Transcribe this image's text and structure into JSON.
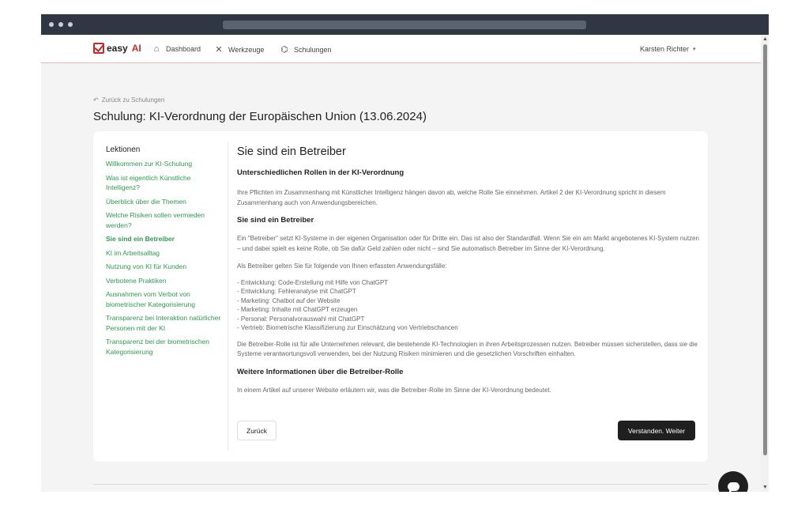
{
  "nav": {
    "logo_text": "easy",
    "logo_ai": "AI",
    "items": [
      {
        "label": "Dashboard",
        "icon": "home-icon"
      },
      {
        "label": "Werkzeuge",
        "icon": "tools-icon"
      },
      {
        "label": "Schulungen",
        "icon": "graduation-cap-icon"
      }
    ],
    "user": "Karsten Richter"
  },
  "back_link": "Zurück zu Schulungen",
  "page_title": "Schulung: KI-Verordnung der Europäischen Union (13.06.2024)",
  "sidebar": {
    "title": "Lektionen",
    "lessons": [
      "Willkommen zur KI-Schulung",
      "Was ist eigentlich Künstliche Intelligenz?",
      "Überblick über die Themen",
      "Welche Risiken sollen vermieden werden?",
      "Sie sind ein Betreiber",
      "KI im Arbeitsalltag",
      "Nutzung von KI für Kunden",
      "Verbotene Praktiken",
      "Ausnahmen vom Verbot von biometrischer Kategorisierung",
      "Transparenz bei Interaktion natürlicher Personen mit der KI",
      "Transparenz bei der biometrischen Kategorisierung"
    ],
    "active_index": 4
  },
  "content": {
    "heading": "Sie sind ein Betreiber",
    "section1_title": "Unterschiedlichen Rollen in der KI-Verordnung",
    "section1_text": "Ihre Pflichten im Zusammenhang mit Künstlicher Intelligenz hängen davon ab, welche Rolle Sie einnehmen. Artikel 2 der KI-Verordnung spricht in diesem Zusammenhang auch von Anwendungsbereichen.",
    "section2_title": "Sie sind ein Betreiber",
    "section2_text": "Ein \"Betreiber\" setzt KI-Systeme in der eigenen Organisation oder für Dritte ein. Das ist also der Standardfall. Wenn Sie ein am Markt angebotenes KI-System nutzen – und dabei spielt es keine Rolle, ob Sie dafür Geld zahlen oder nicht – sind Sie automatisch Betreiber im Sinne der KI-Verordnung.",
    "list_intro": "Als Betreiber gelten Sie für folgende von Ihnen erfassten Anwendungsfälle:",
    "list_items": [
      "- Entwicklung: Code-Erstellung mit Hilfe von ChatGPT",
      "- Entwicklung: Fehleranalyse mit ChatGPT",
      "- Marketing: Chatbot auf der Website",
      "- Marketing: Inhalte mit ChatGPT erzeugen",
      "- Personal: Personalvorauswahl mit ChatGPT",
      "- Vertrieb: Biometrische Klassifizierung zur Einschätzung von Vertriebschancen"
    ],
    "section2_outro": "Die Betreiber-Rolle ist für alle Unternehmen relevant, die bestehende KI-Technologien in ihren Arbeitsprozessen nutzen. Betreiber müssen sicherstellen, dass sie die Systeme verantwortungsvoll verwenden, bei der Nutzung Risiken minimieren und die gesetzlichen Vorschriften einhalten.",
    "section3_title": "Weitere Informationen über die Betreiber-Rolle",
    "section3_text": "In einem Artikel auf unserer Website erläutern wir, was die Betreiber-Rolle im Sinne der KI-Verordnung bedeutet."
  },
  "buttons": {
    "back": "Zurück",
    "next": "Verstanden. Weiter"
  },
  "colors": {
    "brand_red": "#c62828",
    "lesson_green": "#2e9b4e",
    "primary_button": "#1f1f1f"
  }
}
